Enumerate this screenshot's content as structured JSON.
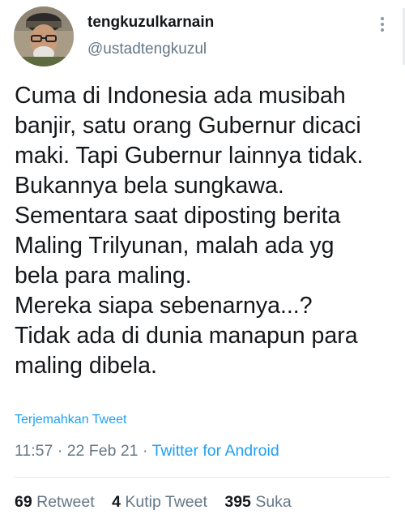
{
  "user": {
    "display_name": "tengkuzulkarnain",
    "handle": "@ustadtengkuzul",
    "avatar_icon": "profile-photo"
  },
  "tweet": {
    "lines": [
      "Cuma di Indonesia ada musibah",
      "banjir, satu orang Gubernur dicaci",
      "maki. Tapi Gubernur lainnya tidak.",
      "Bukannya bela sungkawa.",
      "Sementara saat diposting berita",
      "Maling Trilyunan, malah ada yg",
      "bela para maling.",
      "Mereka siapa sebenarnya...?",
      "Tidak ada di dunia manapun para",
      "maling dibela."
    ],
    "translate_label": "Terjemahkan Tweet",
    "time": "11:57",
    "separator": " · ",
    "date": "22 Feb 21",
    "source": "Twitter for Android"
  },
  "stats": {
    "retweets_count": "69",
    "retweets_label": "Retweet",
    "quotes_count": "4",
    "quotes_label": "Kutip Tweet",
    "likes_count": "395",
    "likes_label": "Suka"
  },
  "colors": {
    "accent": "#1da1f2",
    "text": "#14171a",
    "muted": "#657786"
  }
}
